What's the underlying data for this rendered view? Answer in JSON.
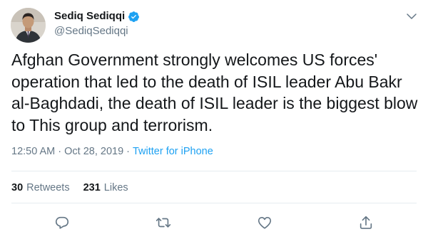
{
  "user": {
    "display_name": "Sediq Sediqqi",
    "handle": "@SediqSediqqi",
    "verified": true
  },
  "tweet": {
    "text": "Afghan Government strongly welcomes US forces' operation that led to the death of ISIL leader Abu Bakr al-Baghdadi, the death of ISIL leader is the biggest blow to This group and terrorism.",
    "time": "12:50 AM",
    "separator": "·",
    "date": "Oct 28, 2019",
    "source": "Twitter for iPhone"
  },
  "stats": {
    "retweets_count": "30",
    "retweets_label": "Retweets",
    "likes_count": "231",
    "likes_label": "Likes"
  },
  "icons": {
    "verified": "verified-badge-icon",
    "caret": "chevron-down-icon",
    "reply": "reply-icon",
    "retweet": "retweet-icon",
    "like": "heart-icon",
    "share": "share-icon"
  },
  "colors": {
    "text": "#14171a",
    "secondary": "#657786",
    "link": "#1da1f2",
    "divider": "#e6ecf0"
  }
}
